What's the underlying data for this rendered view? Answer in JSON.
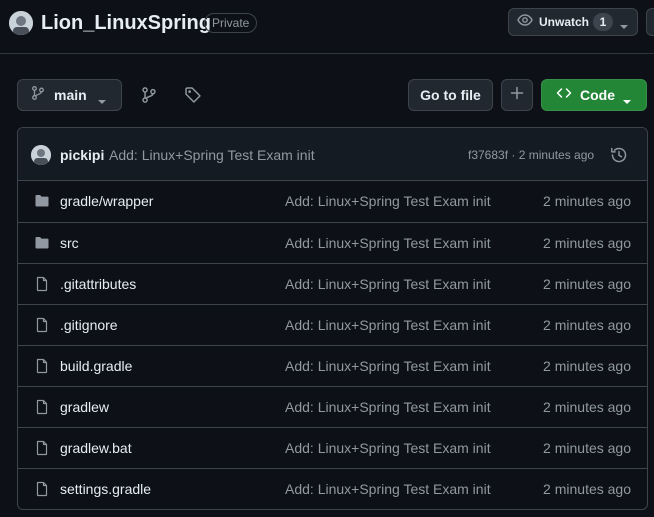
{
  "repo": {
    "name": "Lion_LinuxSpring",
    "visibility": "Private"
  },
  "watch": {
    "label": "Unwatch",
    "count": "1"
  },
  "toolbar": {
    "branch": "main",
    "go_to_file": "Go to file",
    "code_label": "Code"
  },
  "commit": {
    "author": "pickipi",
    "message": "Add: Linux+Spring Test Exam init",
    "meta": "f37683f · 2 minutes ago"
  },
  "files": [
    {
      "name": "gradle/wrapper",
      "type": "folder",
      "message": "Add: Linux+Spring Test Exam init",
      "age": "2 minutes ago"
    },
    {
      "name": "src",
      "type": "folder",
      "message": "Add: Linux+Spring Test Exam init",
      "age": "2 minutes ago"
    },
    {
      "name": ".gitattributes",
      "type": "file",
      "message": "Add: Linux+Spring Test Exam init",
      "age": "2 minutes ago"
    },
    {
      "name": ".gitignore",
      "type": "file",
      "message": "Add: Linux+Spring Test Exam init",
      "age": "2 minutes ago"
    },
    {
      "name": "build.gradle",
      "type": "file",
      "message": "Add: Linux+Spring Test Exam init",
      "age": "2 minutes ago"
    },
    {
      "name": "gradlew",
      "type": "file",
      "message": "Add: Linux+Spring Test Exam init",
      "age": "2 minutes ago"
    },
    {
      "name": "gradlew.bat",
      "type": "file",
      "message": "Add: Linux+Spring Test Exam init",
      "age": "2 minutes ago"
    },
    {
      "name": "settings.gradle",
      "type": "file",
      "message": "Add: Linux+Spring Test Exam init",
      "age": "2 minutes ago"
    }
  ],
  "icons": {
    "avatar": "avatar-icon",
    "watch": "eye-icon",
    "branch": "git-branch-icon",
    "branches": "git-branch-icon",
    "tags": "tag-icon",
    "add": "plus-icon",
    "code": "code-icon",
    "history": "history-icon",
    "folder": "folder-icon",
    "file": "file-icon"
  },
  "colors": {
    "background": "#0d1117",
    "border": "#3d444d",
    "text": "#e6edf3",
    "muted": "#9198a1",
    "code_button": "#238636",
    "folder_icon": "#9198a1"
  }
}
